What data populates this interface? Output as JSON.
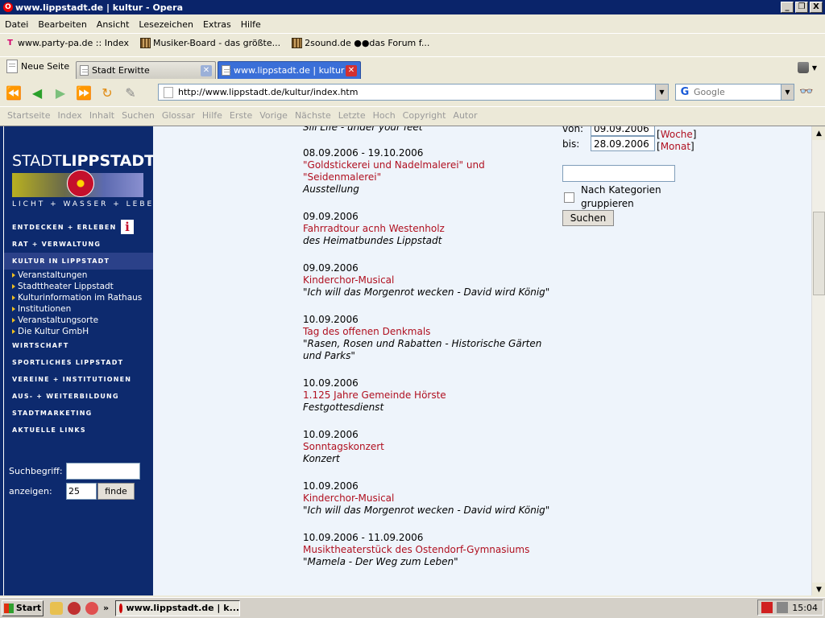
{
  "window": {
    "title": "www.lippstadt.de | kultur - Opera",
    "controls": [
      "_",
      "❐",
      "X"
    ]
  },
  "menu": [
    "Datei",
    "Bearbeiten",
    "Ansicht",
    "Lesezeichen",
    "Extras",
    "Hilfe"
  ],
  "bookmarks": [
    {
      "label": "www.party-pa.de :: Index",
      "icon": "t-logo-icon"
    },
    {
      "label": "Musiker-Board - das größte...",
      "icon": "tile-icon"
    },
    {
      "label": "2sound.de ●●das Forum f...",
      "icon": "tile-icon"
    }
  ],
  "tabs": {
    "new_page": "Neue Seite",
    "items": [
      {
        "label": "Stadt Erwitte",
        "active": false
      },
      {
        "label": "www.lippstadt.de | kultur",
        "active": true
      }
    ]
  },
  "address": {
    "url": "http://www.lippstadt.de/kultur/index.htm",
    "search_placeholder": "Google"
  },
  "nav_links": [
    "Startseite",
    "Index",
    "Inhalt",
    "Suchen",
    "Glossar",
    "Hilfe",
    "Erste",
    "Vorige",
    "Nächste",
    "Letzte",
    "Hoch",
    "Copyright",
    "Autor"
  ],
  "site": {
    "logo_light": "STADT",
    "logo_bold": "LIPPSTADT",
    "tagline": "LICHT + WASSER + LEBEN",
    "menu": [
      {
        "label": "ENTDECKEN + ERLEBEN",
        "active": false
      },
      {
        "label": "RAT + VERWALTUNG",
        "active": false
      },
      {
        "label": "KULTUR IN LIPPSTADT",
        "active": true
      }
    ],
    "submenu": [
      "Veranstaltungen",
      "Stadttheater Lippstadt",
      "Kulturinformation im Rathaus",
      "Institutionen",
      "Veranstaltungsorte",
      "Die Kultur GmbH"
    ],
    "menu2": [
      "WIRTSCHAFT",
      "SPORTLICHES LIPPSTADT",
      "VEREINE + INSTITUTIONEN",
      "AUS- + WEITERBILDUNG",
      "STADTMARKETING",
      "AKTUELLE LINKS"
    ],
    "search": {
      "label": "Suchbegriff:",
      "count_label": "anzeigen:",
      "count_value": "25",
      "button": "finde"
    }
  },
  "events": [
    {
      "date": "",
      "title": "",
      "desc": "Sill Life - under your feet"
    },
    {
      "date": "08.09.2006 - 19.10.2006",
      "title": "\"Goldstickerei und Nadelmalerei\" und \"Seidenmalerei\"",
      "desc": "Ausstellung"
    },
    {
      "date": "09.09.2006",
      "title": "Fahrradtour acnh Westenholz",
      "desc": "des Heimatbundes Lippstadt"
    },
    {
      "date": "09.09.2006",
      "title": "Kinderchor-Musical",
      "desc": "\"Ich will das Morgenrot wecken - David wird König\""
    },
    {
      "date": "10.09.2006",
      "title": "Tag des offenen Denkmals",
      "desc": "\"Rasen, Rosen und Rabatten - Historische Gärten und Parks\""
    },
    {
      "date": "10.09.2006",
      "title": "1.125 Jahre Gemeinde Hörste",
      "desc": "Festgottesdienst"
    },
    {
      "date": "10.09.2006",
      "title": "Sonntagskonzert",
      "desc": "Konzert"
    },
    {
      "date": "10.09.2006",
      "title": "Kinderchor-Musical",
      "desc": "\"Ich will das Morgenrot wecken - David wird König\""
    },
    {
      "date": "10.09.2006 - 11.09.2006",
      "title": "Musiktheaterstück des Ostendorf-Gymnasiums",
      "desc": "\"Mamela - Der Weg zum Leben\""
    }
  ],
  "filter": {
    "von_label": "von:",
    "von_value": "09.09.2006",
    "bis_label": "bis:",
    "bis_value": "28.09.2006",
    "woche": "Woche",
    "monat": "Monat",
    "category_label": "Nach Kategorien gruppieren",
    "search_button": "Suchen"
  },
  "taskbar": {
    "start": "Start",
    "task": "www.lippstadt.de | k...",
    "clock": "15:04"
  },
  "colors": {
    "site_blue": "#0d2a6e",
    "link_red": "#b01020",
    "content_bg": "#eef4fb"
  }
}
